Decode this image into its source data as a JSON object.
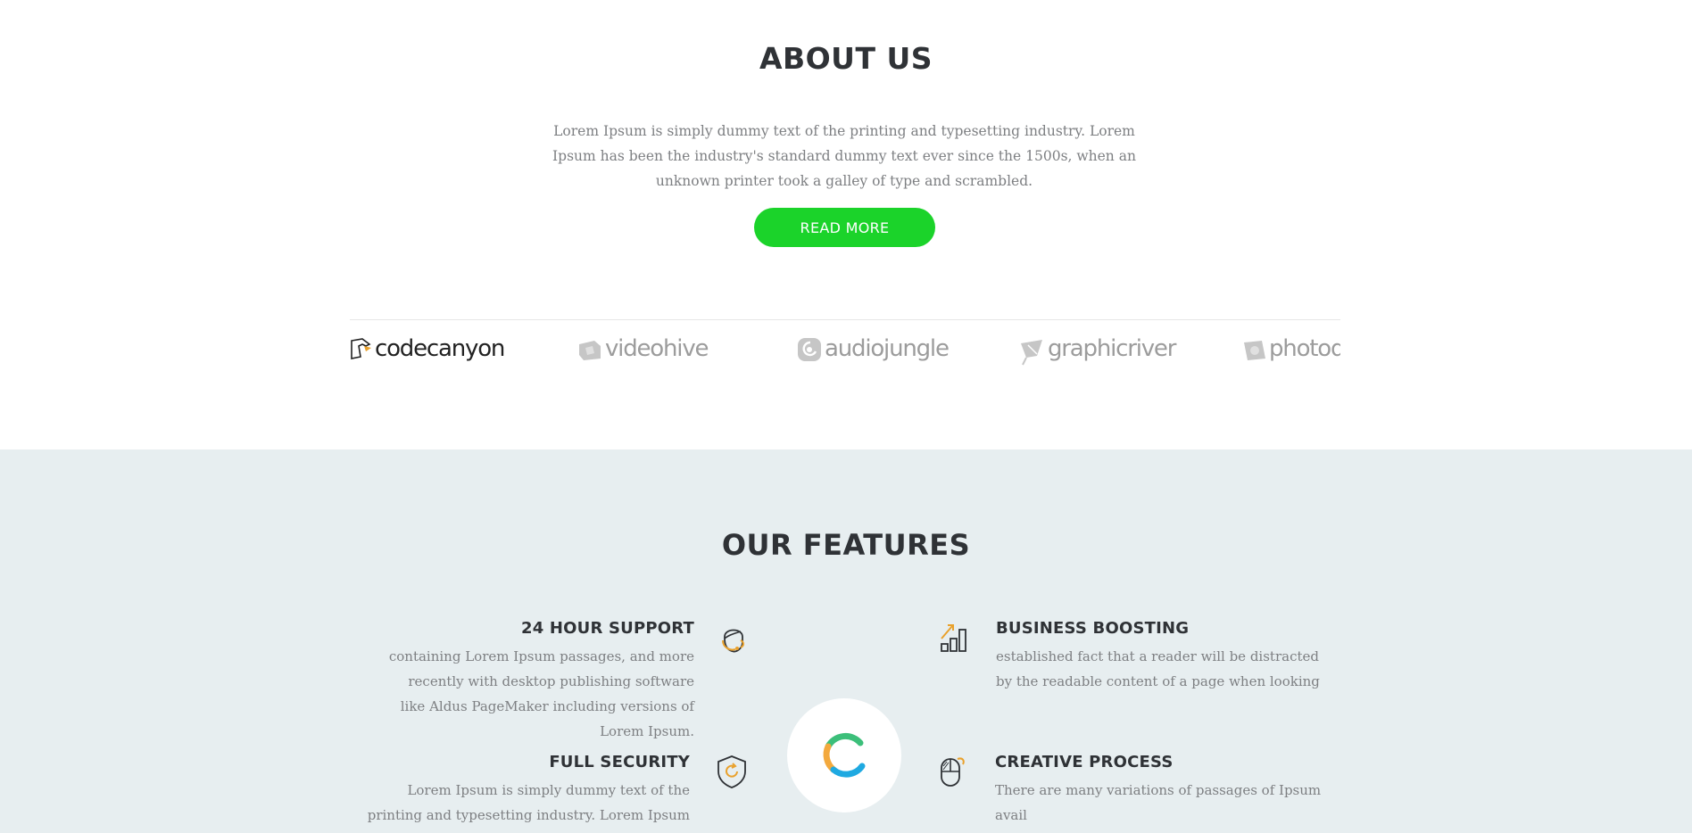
{
  "about": {
    "title": "ABOUT US",
    "text": "Lorem Ipsum is simply dummy text of the printing and typesetting industry. Lorem Ipsum has been the industry's standard dummy text ever since the 1500s, when an unknown printer took a galley of type and scrambled.",
    "button_label": "READ MORE",
    "button_color": "#1bd32a"
  },
  "partners": [
    {
      "name": "codecanyon",
      "icon": "codecanyon-logo-icon"
    },
    {
      "name": "videohive",
      "icon": "videohive-logo-icon"
    },
    {
      "name": "audiojungle",
      "icon": "audiojungle-logo-icon"
    },
    {
      "name": "graphicriver",
      "icon": "graphicriver-logo-icon"
    },
    {
      "name": "photod",
      "icon": "photodune-logo-icon"
    }
  ],
  "features": {
    "title": "OUR FEATURES",
    "background": "#e7eef0",
    "items": [
      {
        "title": "24 HOUR SUPPORT",
        "text": "containing Lorem Ipsum passages, and more recently with desktop publishing software like Aldus PageMaker including versions of Lorem Ipsum.",
        "icon": "headset-support-icon"
      },
      {
        "title": "BUSINESS BOOSTING",
        "text": "established fact that a reader will be distracted by the readable content of a page when looking",
        "icon": "bar-chart-growth-icon"
      },
      {
        "title": "FULL SECURITY",
        "text": "Lorem Ipsum is simply dummy text of the printing and typesetting industry. Lorem Ipsum has been",
        "icon": "shield-icon"
      },
      {
        "title": "CREATIVE PROCESS",
        "text": "There are many variations of passages of Ipsum avail",
        "icon": "mouse-icon"
      }
    ],
    "center_icon": "loading-spinner-icon"
  }
}
